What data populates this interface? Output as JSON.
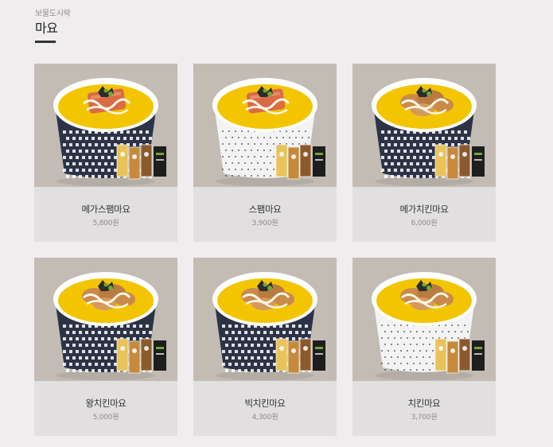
{
  "breadcrumb": "보물도시락",
  "page_title": "마요",
  "products": [
    {
      "name": "메가스팸마요",
      "price": "5,800원",
      "topping": "spam",
      "bowl": "dark",
      "sauces": 3
    },
    {
      "name": "스팸마요",
      "price": "3,900원",
      "topping": "spam",
      "bowl": "light",
      "sauces": 3
    },
    {
      "name": "메가치킨마요",
      "price": "6,000원",
      "topping": "chicken",
      "bowl": "dark",
      "sauces": 3
    },
    {
      "name": "왕치킨마요",
      "price": "5,000원",
      "topping": "chicken",
      "bowl": "dark",
      "sauces": 3
    },
    {
      "name": "빅치킨마요",
      "price": "4,300원",
      "topping": "chicken",
      "bowl": "dark",
      "sauces": 3
    },
    {
      "name": "치킨마요",
      "price": "3,700원",
      "topping": "chicken",
      "bowl": "light",
      "sauces": 3
    }
  ],
  "colors": {
    "image_bg": "#c3bcb5",
    "info_bg": "#e1dfe0",
    "rice": "#f3c500",
    "spam": "#d96b47",
    "chicken": "#c98a4a",
    "seaweed": "#2b2b2b",
    "scallion": "#6fa83a",
    "mayo": "#fbf5e6",
    "bowl_dark": "#2c3346",
    "bowl_light": "#f3f3f3"
  }
}
